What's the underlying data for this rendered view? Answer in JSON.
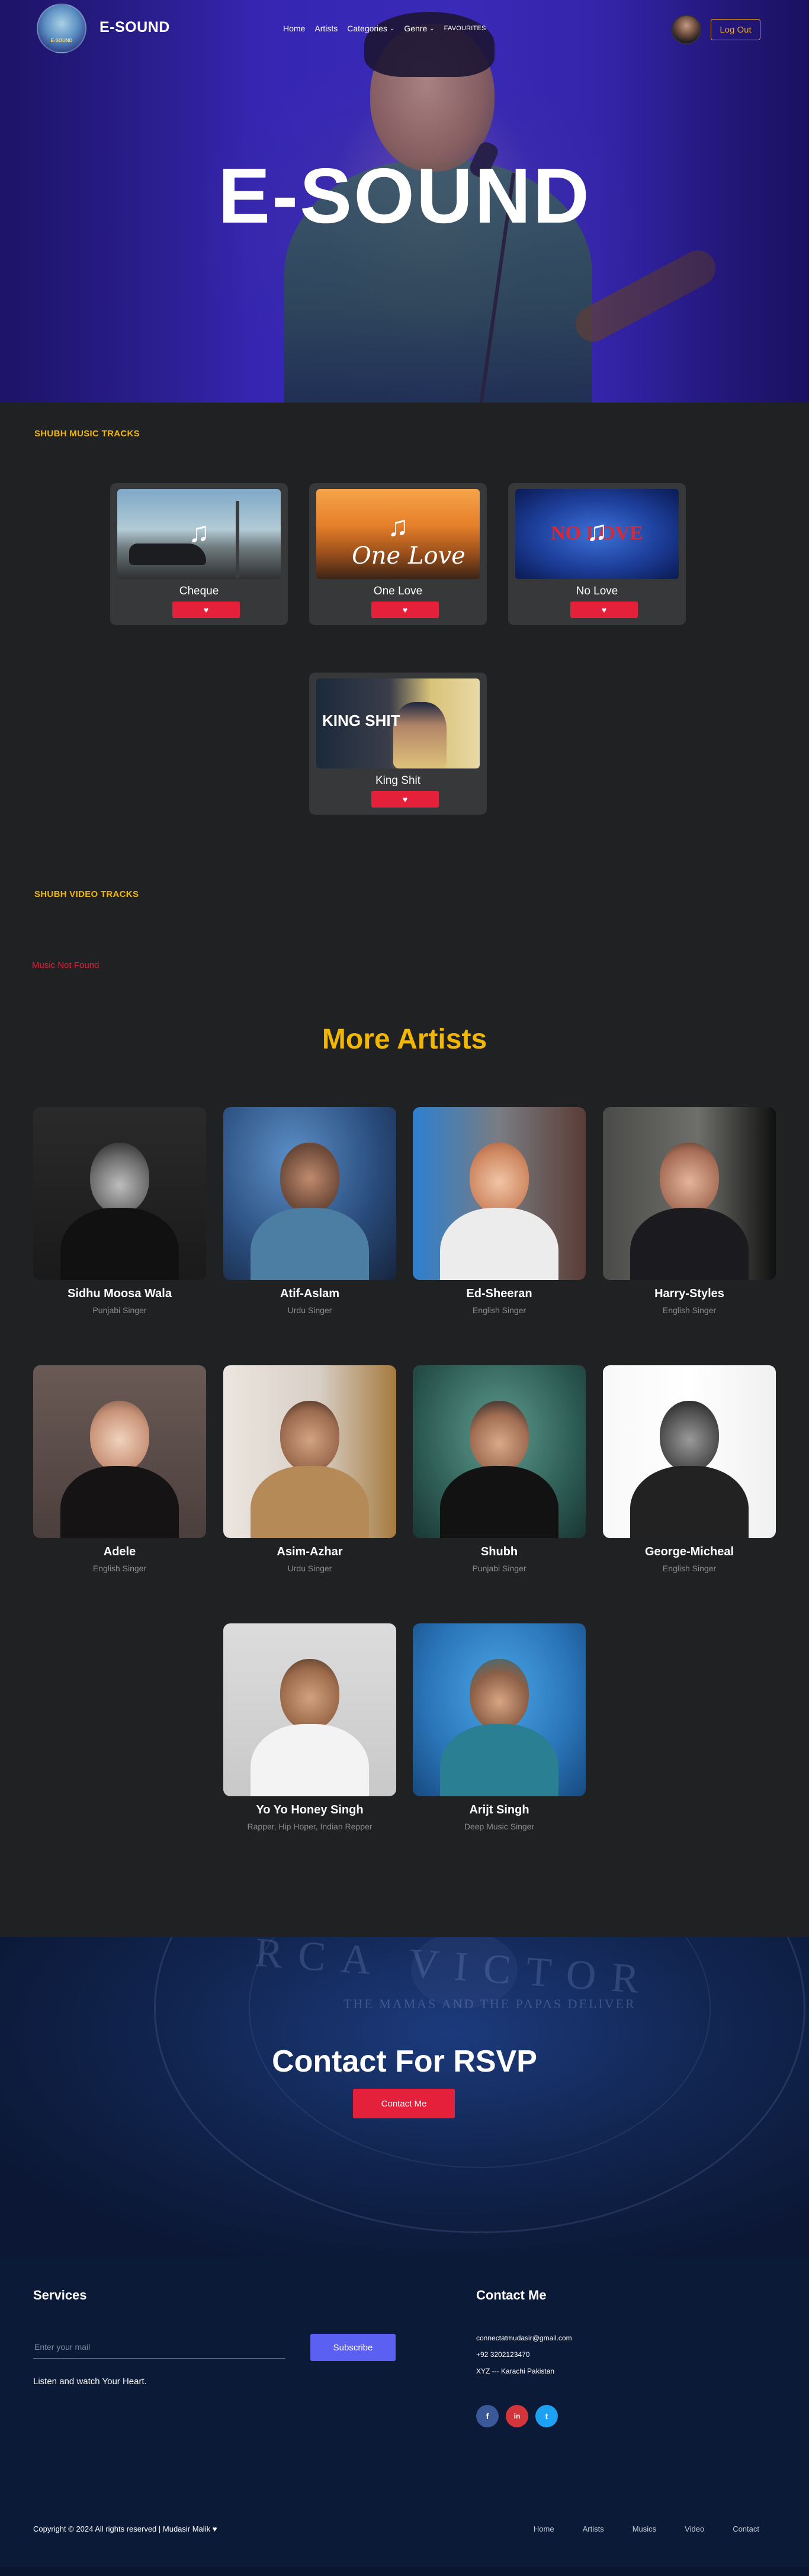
{
  "nav": {
    "logo_text": "E-SOUND",
    "brand": "E-SOUND",
    "menu": [
      {
        "label": "Home"
      },
      {
        "label": "Artists"
      },
      {
        "label": "Categories",
        "dropdown": true
      },
      {
        "label": "Genre",
        "dropdown": true
      },
      {
        "label": "FAVOURITES"
      }
    ],
    "logout": "Log Out"
  },
  "hero": {
    "title": "E-SOUND"
  },
  "music": {
    "label": "SHUBH MUSIC TRACKS",
    "tracks": [
      {
        "title": "Cheque",
        "overlay": ""
      },
      {
        "title": "One Love",
        "overlay": "One Love"
      },
      {
        "title": "No Love",
        "overlay": "NO LOVE"
      },
      {
        "title": "King Shit",
        "overlay": "KING SHIT"
      }
    ],
    "like_icon": "heart-icon"
  },
  "video": {
    "label": "SHUBH VIDEO TRACKS",
    "not_found": "Music Not Found"
  },
  "artists": {
    "title": "More Artists",
    "items": [
      {
        "name": "Sidhu Moosa Wala",
        "role": "Punjabi Singer"
      },
      {
        "name": "Atif-Aslam",
        "role": "Urdu Singer"
      },
      {
        "name": "Ed-Sheeran",
        "role": "English Singer"
      },
      {
        "name": "Harry-Styles",
        "role": "English Singer"
      },
      {
        "name": "Adele",
        "role": "English Singer"
      },
      {
        "name": "Asim-Azhar",
        "role": "Urdu Singer"
      },
      {
        "name": "Shubh",
        "role": "Punjabi Singer"
      },
      {
        "name": "George-Micheal",
        "role": "English Singer"
      },
      {
        "name": "Yo Yo Honey Singh",
        "role": "Rapper, Hip Hoper, Indian Repper"
      },
      {
        "name": "Arijt Singh",
        "role": "Deep Music Singer"
      }
    ]
  },
  "contact": {
    "title": "Contact For RSVP",
    "button": "Contact Me",
    "record_text": "RCA VICTOR",
    "record_sub": "THE MAMAS AND THE PAPAS DELIVER"
  },
  "footer": {
    "services_title": "Services",
    "email_placeholder": "Enter your mail",
    "subscribe": "Subscribe",
    "tagline": "Listen and watch Your Heart.",
    "contact_title": "Contact Me",
    "email": "connectatmudasir@gmail.com",
    "phone": "+92 3202123470",
    "address": "XYZ --- Karachi Pakistan",
    "social": [
      {
        "icon": "facebook-icon",
        "glyph": "f",
        "color": "#3b5998"
      },
      {
        "icon": "linkedin-icon",
        "glyph": "in",
        "color": "#d4353a"
      },
      {
        "icon": "twitter-icon",
        "glyph": "t",
        "color": "#1da1f2"
      }
    ],
    "copyright": "Copyright © 2024 All rights reserved | Mudasir Malik",
    "links": [
      "Home",
      "Artists",
      "Musics",
      "Video",
      "Contact"
    ]
  }
}
